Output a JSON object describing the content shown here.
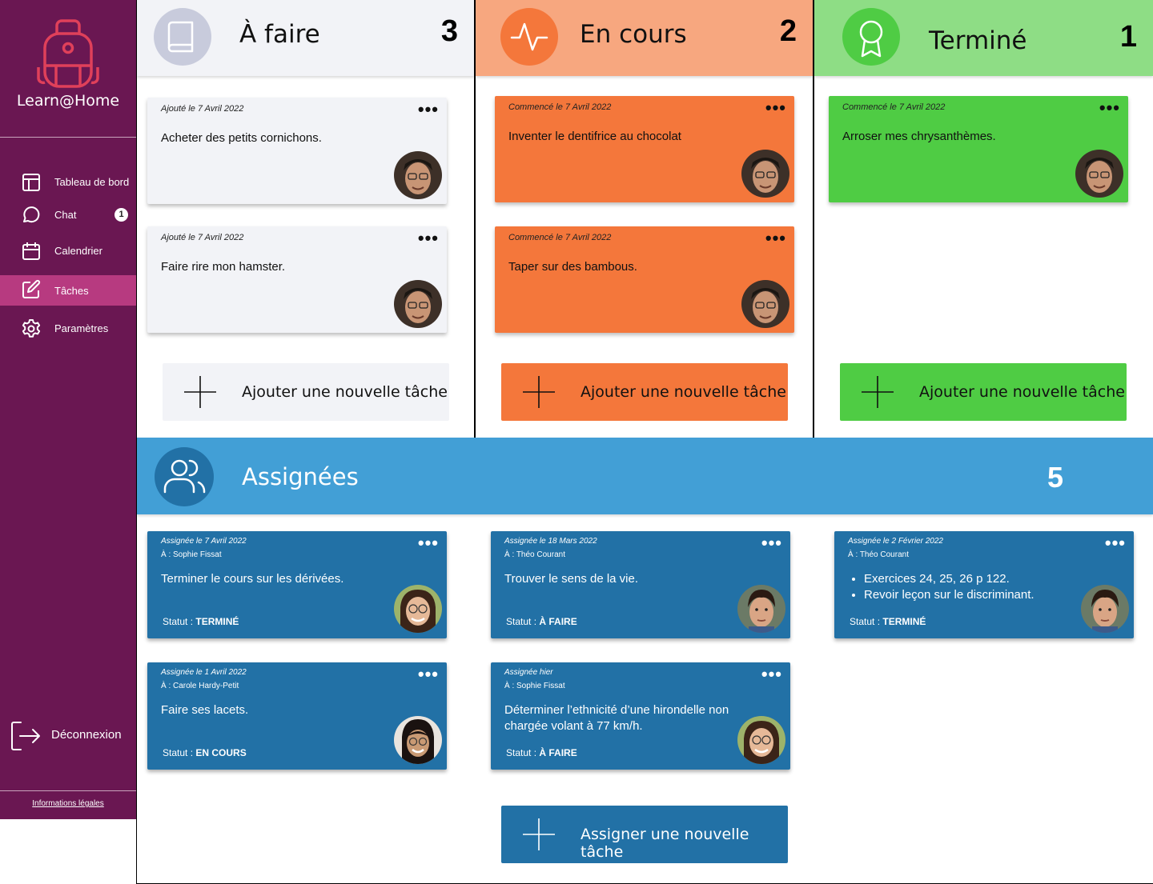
{
  "app": {
    "name": "Learn@Home"
  },
  "sidebar": {
    "items": [
      {
        "label": "Tableau de bord",
        "icon": "dashboard-icon"
      },
      {
        "label": "Chat",
        "icon": "chat-icon",
        "badge": "1"
      },
      {
        "label": "Calendrier",
        "icon": "calendar-icon"
      },
      {
        "label": "Tâches",
        "icon": "edit-icon",
        "active": true
      },
      {
        "label": "Paramètres",
        "icon": "gear-icon"
      }
    ],
    "logout_label": "Déconnexion",
    "legal_label": "Informations légales"
  },
  "columns": [
    {
      "title": "À faire",
      "count": "3",
      "color": "#f2f3f7",
      "cards": [
        {
          "date": "Ajouté le 7 Avril 2022",
          "text": "Acheter des petits cornichons."
        },
        {
          "date": "Ajouté le 7 Avril 2022",
          "text": "Faire rire mon hamster."
        }
      ],
      "add_label": "Ajouter une nouvelle tâche"
    },
    {
      "title": "En cours",
      "count": "2",
      "color": "#f4773b",
      "cards": [
        {
          "date": "Commencé le 7 Avril 2022",
          "text": "Inventer le dentifrice au chocolat"
        },
        {
          "date": "Commencé le 7 Avril 2022",
          "text": "Taper sur des bambous."
        }
      ],
      "add_label": "Ajouter une nouvelle tâche"
    },
    {
      "title": "Terminé",
      "count": "1",
      "color": "#4fcc44",
      "cards": [
        {
          "date": "Commencé le 7 Avril 2022",
          "text": "Arroser mes chrysanthèmes."
        }
      ],
      "add_label": "Ajouter une nouvelle tâche"
    }
  ],
  "assigned": {
    "title": "Assignées",
    "count": "5",
    "status_prefix": "Statut : ",
    "cards": [
      {
        "date": "Assignée le 7 Avril 2022",
        "to": "À : Sophie Fissat",
        "text": "Terminer le cours sur les dérivées.",
        "status": "TERMINÉ"
      },
      {
        "date": "Assignée le 18 Mars 2022",
        "to": "À : Théo Courant",
        "text": "Trouver le sens de la vie.",
        "status": "À FAIRE"
      },
      {
        "date": "Assignée le 2 Février 2022",
        "to": "À : Théo Courant",
        "bullets": [
          "Exercices 24, 25, 26 p 122.",
          "Revoir leçon sur le discriminant."
        ],
        "status": "TERMINÉ"
      },
      {
        "date": "Assignée le 1 Avril 2022",
        "to": "À : Carole Hardy-Petit",
        "text": "Faire ses lacets.",
        "status": "EN COURS"
      },
      {
        "date": "Assignée hier",
        "to": "À : Sophie Fissat",
        "text": "Déterminer l’ethnicité d’une hirondelle non chargée volant à 77 km/h.",
        "status": "À FAIRE"
      }
    ],
    "add_label": "Assigner une nouvelle tâche"
  },
  "colors": {
    "sidebar": "#6a1752",
    "sidebar_active": "#b73a80",
    "todo_header": "#f2f3f7",
    "inprogress_header": "#f7a77f",
    "inprogress": "#f4773b",
    "done_header": "#8edd85",
    "done": "#4fcc44",
    "assigned_header": "#429fd6",
    "assigned": "#2271a6"
  }
}
